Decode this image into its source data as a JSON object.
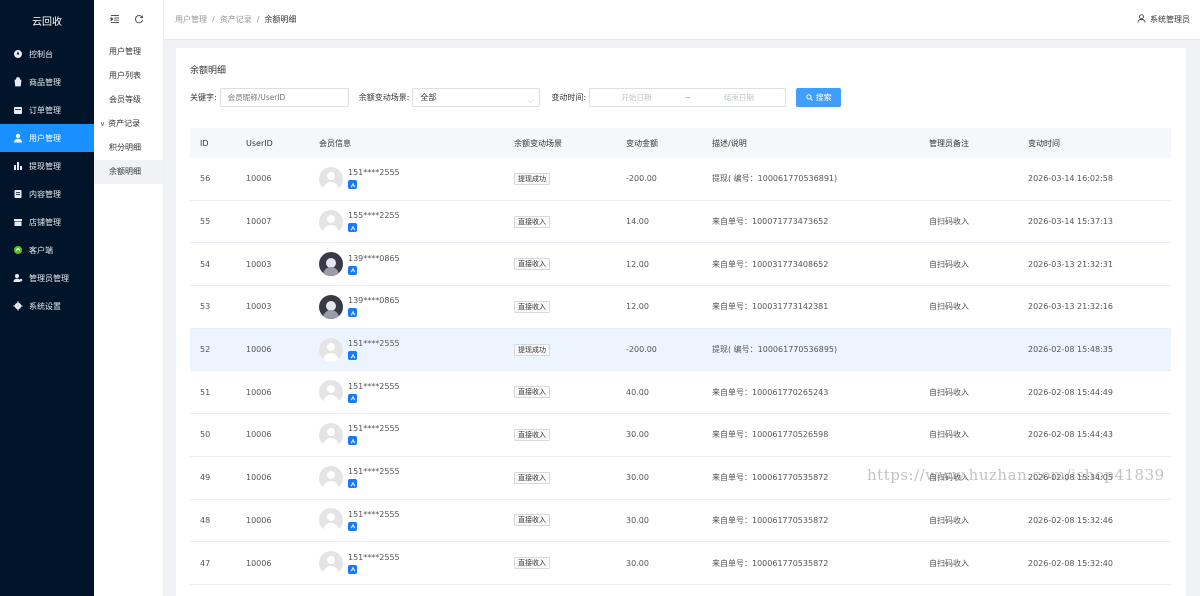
{
  "app": {
    "brand": "云回收"
  },
  "sidebar": {
    "items": [
      {
        "label": "控制台",
        "icon": "dashboard-icon"
      },
      {
        "label": "商品管理",
        "icon": "goods-icon"
      },
      {
        "label": "订单管理",
        "icon": "order-icon"
      },
      {
        "label": "用户管理",
        "icon": "user-icon",
        "active": true
      },
      {
        "label": "提现管理",
        "icon": "withdraw-icon"
      },
      {
        "label": "内容管理",
        "icon": "content-icon"
      },
      {
        "label": "店铺管理",
        "icon": "shop-icon"
      },
      {
        "label": "客户端",
        "icon": "client-icon"
      },
      {
        "label": "管理员管理",
        "icon": "admin-icon"
      },
      {
        "label": "系统设置",
        "icon": "settings-icon"
      }
    ]
  },
  "submenu": {
    "items": [
      {
        "label": "用户管理"
      },
      {
        "label": "用户列表"
      },
      {
        "label": "会员等级"
      },
      {
        "label": "资产记录",
        "group": true
      },
      {
        "label": "积分明细"
      },
      {
        "label": "余额明细",
        "active": true
      }
    ]
  },
  "header": {
    "breadcrumb": [
      "用户管理",
      "资产记录",
      "余额明细"
    ],
    "user": "系统管理员"
  },
  "card": {
    "title": "余额明细"
  },
  "filters": {
    "keyword_label": "关键字:",
    "keyword_placeholder": "会员昵称/UserID",
    "scene_label": "余额变动场景:",
    "scene_value": "全部",
    "time_label": "变动时间:",
    "start_placeholder": "开始日期",
    "range_sep": "~",
    "end_placeholder": "结束日期",
    "search_label": "搜索"
  },
  "table": {
    "headers": [
      "ID",
      "UserID",
      "会员信息",
      "余额变动场景",
      "变动金额",
      "描述/说明",
      "管理员备注",
      "变动时间"
    ],
    "rows": [
      {
        "id": "56",
        "uid": "10006",
        "phone": "151****2555",
        "photo": false,
        "scene": "提现成功",
        "amount": "-200.00",
        "desc": "提现( 编号：100061770536891)",
        "note": "",
        "time": "2026-03-14 16:02:58"
      },
      {
        "id": "55",
        "uid": "10007",
        "phone": "155****2255",
        "photo": false,
        "scene": "直接收入",
        "amount": "14.00",
        "desc": "来自单号：100071773473652",
        "note": "自扫码收入",
        "time": "2026-03-14 15:37:13"
      },
      {
        "id": "54",
        "uid": "10003",
        "phone": "139****0865",
        "photo": true,
        "scene": "直接收入",
        "amount": "12.00",
        "desc": "来自单号：100031773408652",
        "note": "自扫码收入",
        "time": "2026-03-13 21:32:31"
      },
      {
        "id": "53",
        "uid": "10003",
        "phone": "139****0865",
        "photo": true,
        "scene": "直接收入",
        "amount": "12.00",
        "desc": "来自单号：100031773142381",
        "note": "自扫码收入",
        "time": "2026-03-13 21:32:16"
      },
      {
        "id": "52",
        "uid": "10006",
        "phone": "151****2555",
        "photo": false,
        "scene": "提现成功",
        "amount": "-200.00",
        "desc": "提现( 编号：100061770536895)",
        "note": "",
        "time": "2026-02-08 15:48:35",
        "highlight": true
      },
      {
        "id": "51",
        "uid": "10006",
        "phone": "151****2555",
        "photo": false,
        "scene": "直接收入",
        "amount": "40.00",
        "desc": "来自单号：100061770265243",
        "note": "自扫码收入",
        "time": "2026-02-08 15:44:49"
      },
      {
        "id": "50",
        "uid": "10006",
        "phone": "151****2555",
        "photo": false,
        "scene": "直接收入",
        "amount": "30.00",
        "desc": "来自单号：100061770526598",
        "note": "自扫码收入",
        "time": "2026-02-08 15:44:43"
      },
      {
        "id": "49",
        "uid": "10006",
        "phone": "151****2555",
        "photo": false,
        "scene": "直接收入",
        "amount": "30.00",
        "desc": "来自单号：100061770535872",
        "note": "自扫码收入",
        "time": "2026-02-08 15:34:05"
      },
      {
        "id": "48",
        "uid": "10006",
        "phone": "151****2555",
        "photo": false,
        "scene": "直接收入",
        "amount": "30.00",
        "desc": "来自单号：100061770535872",
        "note": "自扫码收入",
        "time": "2026-02-08 15:32:46"
      },
      {
        "id": "47",
        "uid": "10006",
        "phone": "151****2555",
        "photo": false,
        "scene": "直接收入",
        "amount": "30.00",
        "desc": "来自单号：100061770535872",
        "note": "自扫码收入",
        "time": "2026-02-08 15:32:40"
      }
    ]
  },
  "watermark": "https://www.huzhan.com/ishop41839",
  "colors": {
    "sidebar_bg": "#001529",
    "active": "#1890ff",
    "button": "#409eff",
    "row_highlight": "#ecf5ff"
  }
}
